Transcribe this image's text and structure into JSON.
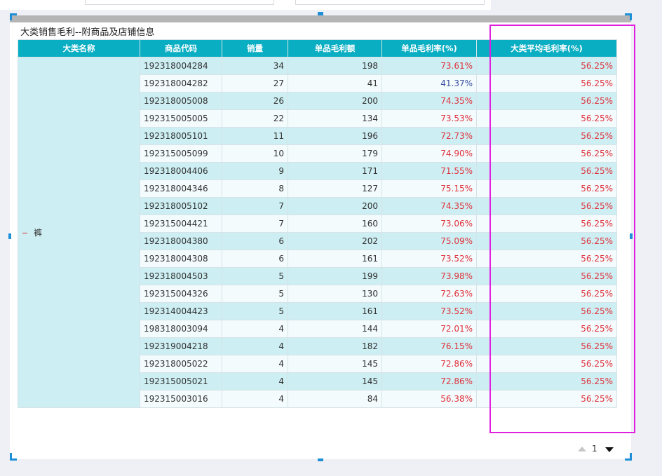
{
  "report": {
    "title": "大类销售毛利--附商品及店铺信息",
    "columns": [
      "大类名称",
      "商品代码",
      "销量",
      "单品毛利额",
      "单品毛利率(%)",
      "大类平均毛利率(%)"
    ],
    "category": "裤",
    "rows": [
      {
        "code": "192318004284",
        "qty": "34",
        "profit": "198",
        "rate": "73.61%",
        "avg": "56.25%"
      },
      {
        "code": "192318004282",
        "qty": "27",
        "profit": "41",
        "rate": "41.37%",
        "avg": "56.25%"
      },
      {
        "code": "192318005008",
        "qty": "26",
        "profit": "200",
        "rate": "74.35%",
        "avg": "56.25%"
      },
      {
        "code": "192315005005",
        "qty": "22",
        "profit": "134",
        "rate": "73.53%",
        "avg": "56.25%"
      },
      {
        "code": "192318005101",
        "qty": "11",
        "profit": "196",
        "rate": "72.73%",
        "avg": "56.25%"
      },
      {
        "code": "192315005099",
        "qty": "10",
        "profit": "179",
        "rate": "74.90%",
        "avg": "56.25%"
      },
      {
        "code": "192318004406",
        "qty": "9",
        "profit": "171",
        "rate": "71.55%",
        "avg": "56.25%"
      },
      {
        "code": "192318004346",
        "qty": "8",
        "profit": "127",
        "rate": "75.15%",
        "avg": "56.25%"
      },
      {
        "code": "192318005102",
        "qty": "7",
        "profit": "200",
        "rate": "74.35%",
        "avg": "56.25%"
      },
      {
        "code": "192315004421",
        "qty": "7",
        "profit": "160",
        "rate": "73.06%",
        "avg": "56.25%"
      },
      {
        "code": "192318004380",
        "qty": "6",
        "profit": "202",
        "rate": "75.09%",
        "avg": "56.25%"
      },
      {
        "code": "192318004308",
        "qty": "6",
        "profit": "161",
        "rate": "73.52%",
        "avg": "56.25%"
      },
      {
        "code": "192318004503",
        "qty": "5",
        "profit": "199",
        "rate": "73.98%",
        "avg": "56.25%"
      },
      {
        "code": "192315004326",
        "qty": "5",
        "profit": "130",
        "rate": "72.63%",
        "avg": "56.25%"
      },
      {
        "code": "192314004423",
        "qty": "5",
        "profit": "161",
        "rate": "73.52%",
        "avg": "56.25%"
      },
      {
        "code": "198318003094",
        "qty": "4",
        "profit": "144",
        "rate": "72.01%",
        "avg": "56.25%"
      },
      {
        "code": "192319004218",
        "qty": "4",
        "profit": "182",
        "rate": "76.15%",
        "avg": "56.25%"
      },
      {
        "code": "192318005022",
        "qty": "4",
        "profit": "145",
        "rate": "72.86%",
        "avg": "56.25%"
      },
      {
        "code": "192315005021",
        "qty": "4",
        "profit": "145",
        "rate": "72.86%",
        "avg": "56.25%"
      },
      {
        "code": "192315003016",
        "qty": "4",
        "profit": "84",
        "rate": "56.38%",
        "avg": "56.25%"
      }
    ]
  },
  "pager": {
    "page": "1"
  },
  "colors": {
    "header_bg": "#0aaec3",
    "row_odd": "#cdeef2",
    "row_even": "#f3fbfd",
    "rate_red": "#e0323c",
    "rate_blue": "#3d4fa0",
    "highlight_box": "#e020e0",
    "handle_blue": "#1f8fd8"
  },
  "icons": {
    "collapse": "minus-icon",
    "page_prev": "triangle-up-icon",
    "page_next": "triangle-down-icon"
  }
}
